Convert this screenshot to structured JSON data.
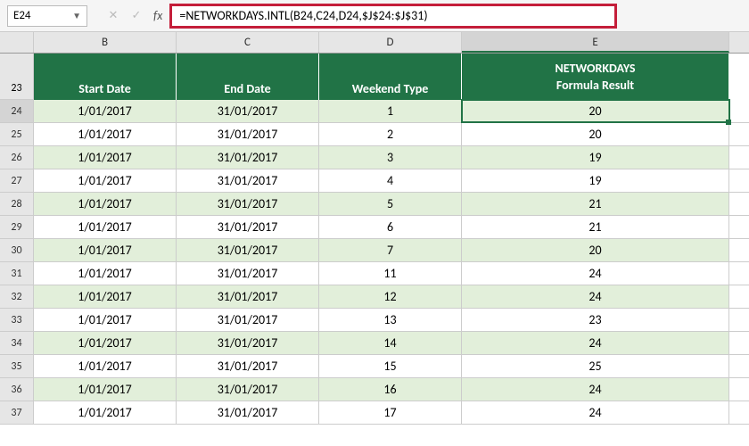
{
  "name_box": "E24",
  "formula": "=NETWORKDAYS.INTL(B24,C24,D24,$J$24:$J$31)",
  "columns": {
    "b": "B",
    "c": "C",
    "d": "D",
    "e": "E"
  },
  "header_row_num": "23",
  "headers": {
    "start_date": "Start Date",
    "end_date": "End Date",
    "weekend_type": "Weekend Type",
    "e_top": "NETWORKDAYS",
    "e_bottom": "Formula Result"
  },
  "chart_data": {
    "type": "table",
    "columns": [
      "row",
      "Start Date",
      "End Date",
      "Weekend Type",
      "NETWORKDAYS Formula Result"
    ],
    "rows": [
      {
        "row": "24",
        "start": "1/01/2017",
        "end": "31/01/2017",
        "wtype": "1",
        "result": "20"
      },
      {
        "row": "25",
        "start": "1/01/2017",
        "end": "31/01/2017",
        "wtype": "2",
        "result": "20"
      },
      {
        "row": "26",
        "start": "1/01/2017",
        "end": "31/01/2017",
        "wtype": "3",
        "result": "19"
      },
      {
        "row": "27",
        "start": "1/01/2017",
        "end": "31/01/2017",
        "wtype": "4",
        "result": "19"
      },
      {
        "row": "28",
        "start": "1/01/2017",
        "end": "31/01/2017",
        "wtype": "5",
        "result": "21"
      },
      {
        "row": "29",
        "start": "1/01/2017",
        "end": "31/01/2017",
        "wtype": "6",
        "result": "21"
      },
      {
        "row": "30",
        "start": "1/01/2017",
        "end": "31/01/2017",
        "wtype": "7",
        "result": "20"
      },
      {
        "row": "31",
        "start": "1/01/2017",
        "end": "31/01/2017",
        "wtype": "11",
        "result": "24"
      },
      {
        "row": "32",
        "start": "1/01/2017",
        "end": "31/01/2017",
        "wtype": "12",
        "result": "24"
      },
      {
        "row": "33",
        "start": "1/01/2017",
        "end": "31/01/2017",
        "wtype": "13",
        "result": "23"
      },
      {
        "row": "34",
        "start": "1/01/2017",
        "end": "31/01/2017",
        "wtype": "14",
        "result": "24"
      },
      {
        "row": "35",
        "start": "1/01/2017",
        "end": "31/01/2017",
        "wtype": "15",
        "result": "25"
      },
      {
        "row": "36",
        "start": "1/01/2017",
        "end": "31/01/2017",
        "wtype": "16",
        "result": "24"
      },
      {
        "row": "37",
        "start": "1/01/2017",
        "end": "31/01/2017",
        "wtype": "17",
        "result": "24"
      }
    ]
  },
  "selected_row": "24"
}
